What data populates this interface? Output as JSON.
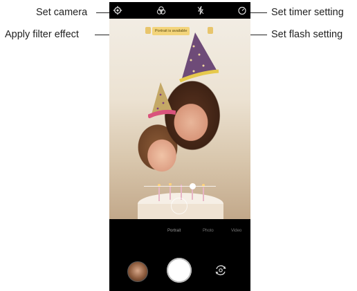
{
  "callouts": {
    "set_camera": "Set camera",
    "apply_filter_effect": "Apply filter effect",
    "set_timer_setting": "Set timer setting",
    "set_flash_setting": "Set flash setting"
  },
  "viewfinder": {
    "notice_chip": "Portrait is available"
  },
  "modes": [
    "Portrait",
    "Photo",
    "Video"
  ],
  "icons": {
    "settings": "gear-icon",
    "filter": "filter-icon",
    "flash": "flash-icon",
    "timer": "timer-icon",
    "gallery": "gallery-thumbnail",
    "shutter": "shutter-button",
    "switch_camera": "switch-camera-icon"
  },
  "colors": {
    "background": "#ffffff",
    "phone": "#000000",
    "chip": "#f3d47a",
    "shutter": "#ffffff"
  }
}
